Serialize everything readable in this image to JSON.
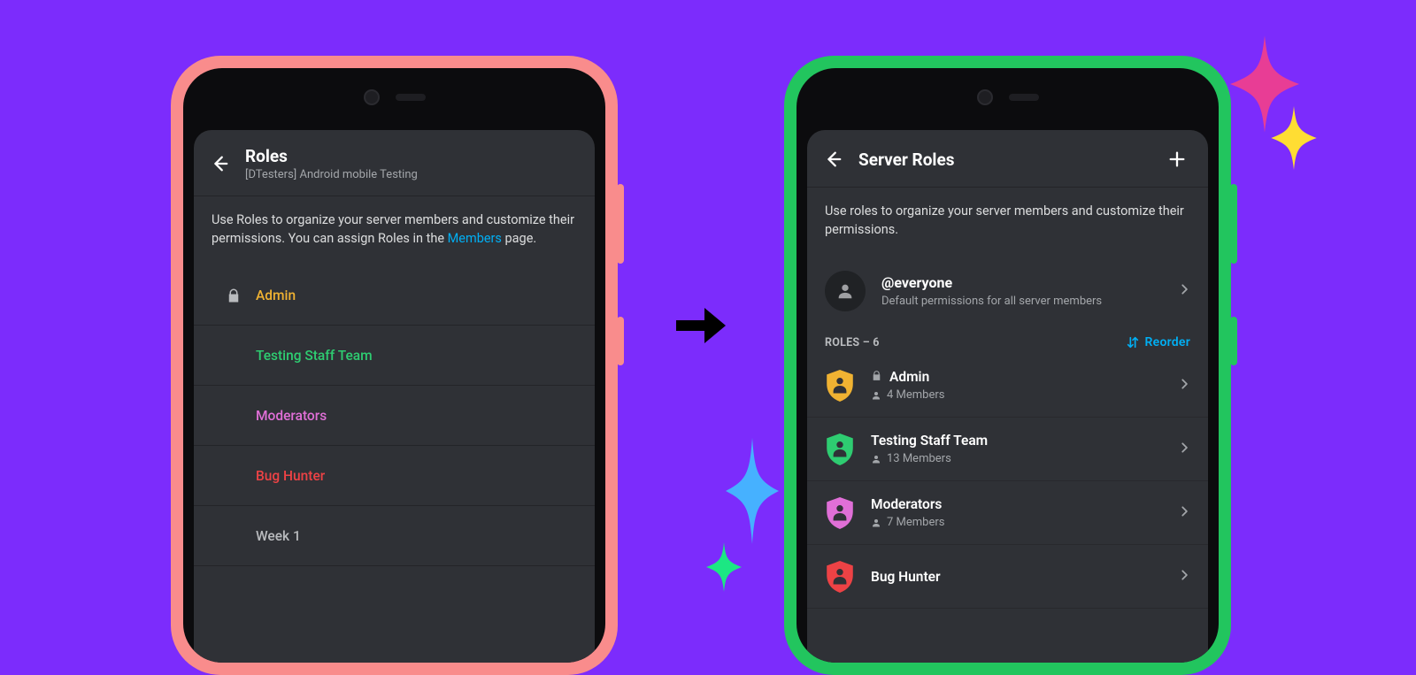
{
  "old": {
    "title": "Roles",
    "subtitle": "[DTesters] Android mobile Testing",
    "desc_part1": "Use Roles to organize your server members and customize their permissions. You can assign Roles in the ",
    "desc_link": "Members",
    "desc_part2": " page.",
    "roles": [
      {
        "name": "Admin",
        "color": "#f0b232",
        "locked": true
      },
      {
        "name": "Testing Staff Team",
        "color": "#2ecc71",
        "locked": false
      },
      {
        "name": "Moderators",
        "color": "#e06fd7",
        "locked": false
      },
      {
        "name": "Bug Hunter",
        "color": "#ed4245",
        "locked": false
      },
      {
        "name": "Week 1",
        "color": "#b9bbbe",
        "locked": false
      }
    ]
  },
  "new": {
    "title": "Server Roles",
    "desc": "Use roles to organize your server members and customize their permissions.",
    "everyone_name": "@everyone",
    "everyone_sub": "Default permissions for all server members",
    "section_label": "ROLES – 6",
    "reorder_label": "Reorder",
    "roles": [
      {
        "name": "Admin",
        "members": "4 Members",
        "shield": "#f0b232",
        "locked": true
      },
      {
        "name": "Testing Staff Team",
        "members": "13 Members",
        "shield": "#2ecc71",
        "locked": false
      },
      {
        "name": "Moderators",
        "members": "7 Members",
        "shield": "#e06fd7",
        "locked": false
      },
      {
        "name": "Bug Hunter",
        "members": "",
        "shield": "#ed4245",
        "locked": false
      }
    ]
  },
  "sparkles": {
    "pink": "#e83d95",
    "yellow": "#ffdd33",
    "blue": "#46b1ff",
    "green": "#1ce783"
  }
}
